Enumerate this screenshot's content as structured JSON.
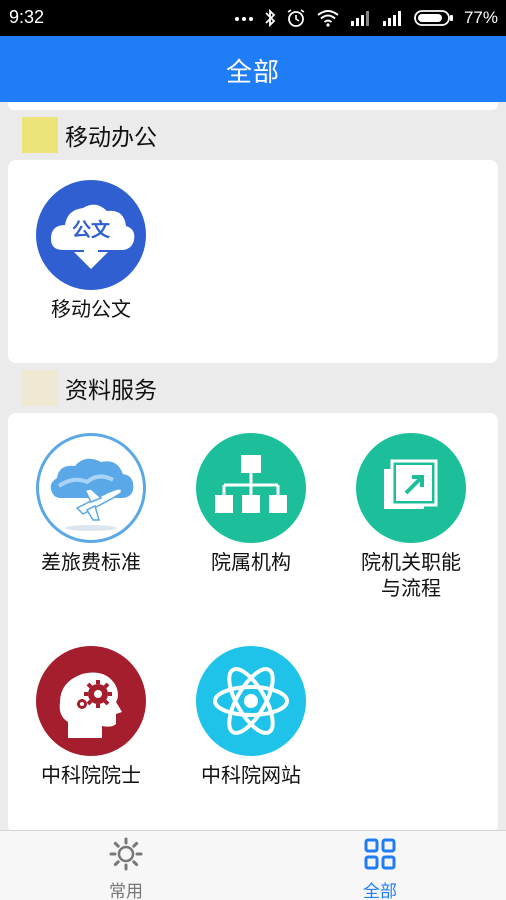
{
  "status_bar": {
    "time": "9:32",
    "battery_percent": "77%",
    "icons": [
      "dots-icon",
      "bluetooth-icon",
      "alarm-icon",
      "wifi-icon",
      "signal-icon",
      "signal-icon",
      "battery-icon"
    ]
  },
  "header": {
    "title": "全部",
    "background_color": "#1f7ef7"
  },
  "sections": [
    {
      "title": "移动办公",
      "swatch_color": "#ece47a",
      "apps": [
        {
          "label": "移动公文",
          "icon": "document-download-icon",
          "icon_text": "公文",
          "color": "#2f5fd0"
        }
      ]
    },
    {
      "title": "资料服务",
      "swatch_color": "#efe8d2",
      "apps": [
        {
          "label": "差旅费标准",
          "icon": "airplane-cloud-icon",
          "color": "#5aa8e8"
        },
        {
          "label": "院属机构",
          "icon": "org-chart-icon",
          "color": "#1dbf9a"
        },
        {
          "label": "院机关职能\n与流程",
          "label_line1": "院机关职能",
          "label_line2": "与流程",
          "icon": "external-link-icon",
          "color": "#1dbf9a"
        },
        {
          "label": "中科院院士",
          "icon": "head-gears-icon",
          "color": "#a51e2e"
        },
        {
          "label": "中科院网站",
          "icon": "atom-icon",
          "color": "#1fc3ea"
        }
      ]
    }
  ],
  "bottom_nav": [
    {
      "label": "常用",
      "icon": "gear-icon",
      "active": false,
      "color": "#777777"
    },
    {
      "label": "全部",
      "icon": "grid-icon",
      "active": true,
      "color": "#1f7ef7"
    }
  ]
}
